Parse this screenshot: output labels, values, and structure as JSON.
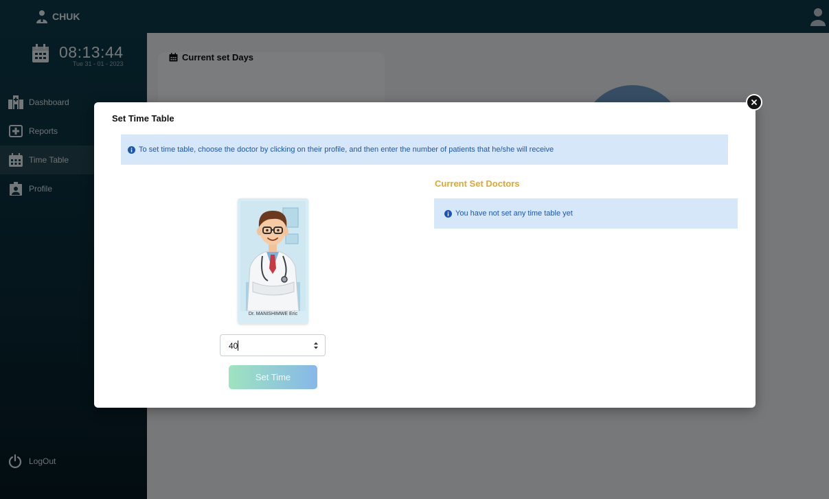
{
  "app": {
    "brand": "CHUK"
  },
  "clock": {
    "time": "08:13:44",
    "date": "Tue 31 - 01 - 2023"
  },
  "sidebar": {
    "items": [
      {
        "label": "Dashboard",
        "icon": "hospital-icon",
        "active": false
      },
      {
        "label": "Reports",
        "icon": "medical-report-icon",
        "active": false
      },
      {
        "label": "Time Table",
        "icon": "calendar-icon",
        "active": true
      },
      {
        "label": "Profile",
        "icon": "id-card-icon",
        "active": false
      }
    ],
    "logout_label": "LogOut"
  },
  "content": {
    "card_title": "Current set Days"
  },
  "modal": {
    "title": "Set Time Table",
    "info_text": "To set time table, choose the doctor by clicking on their profile, and then enter the number of patients that he/she will receive",
    "doctor": {
      "name": "Dr. MANISHIMWE Eric"
    },
    "patients_input": {
      "value": "40"
    },
    "set_time_label": "Set Time",
    "current_doctors_title": "Current Set Doctors",
    "empty_text": "You have not set any time table yet"
  },
  "colors": {
    "accent_orange": "#e0a82e",
    "info_bg": "#d7e7fa",
    "info_text": "#1a56b0",
    "sidebar_bg": "#0d3a4a"
  }
}
